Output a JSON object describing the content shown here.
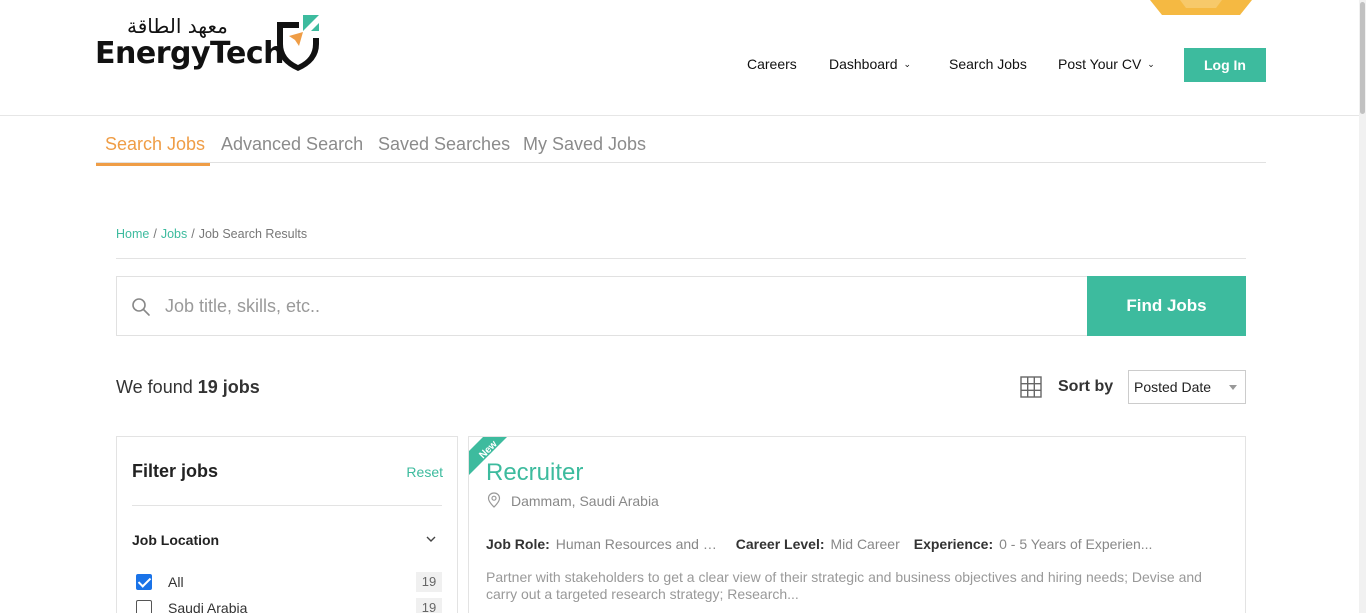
{
  "brand": {
    "arabic_name": "معهد الطاقة",
    "english_name": "EnergyTech"
  },
  "colors": {
    "accent_green": "#3dbb9e",
    "accent_orange": "#ef9d46",
    "checkbox_blue": "#1a73e8"
  },
  "nav": {
    "items": [
      {
        "label": "Careers",
        "dropdown": false
      },
      {
        "label": "Dashboard",
        "dropdown": true
      },
      {
        "label": "Search Jobs",
        "dropdown": false
      },
      {
        "label": "Post Your CV",
        "dropdown": true
      }
    ],
    "login_label": "Log In"
  },
  "tabs": [
    {
      "label": "Search Jobs",
      "active": true
    },
    {
      "label": "Advanced Search",
      "active": false
    },
    {
      "label": "Saved Searches",
      "active": false
    },
    {
      "label": "My Saved Jobs",
      "active": false
    }
  ],
  "breadcrumb": {
    "home": "Home",
    "jobs": "Jobs",
    "current": "Job Search Results",
    "separator": "/"
  },
  "search": {
    "placeholder": "Job title, skills, etc..",
    "value": "",
    "button_label": "Find Jobs"
  },
  "results": {
    "prefix": "We found",
    "count_text": "19 jobs",
    "sort_label": "Sort by",
    "sort_value": "Posted Date"
  },
  "filter": {
    "title": "Filter jobs",
    "reset_label": "Reset",
    "section_title": "Job Location",
    "options": [
      {
        "label": "All",
        "count": "19",
        "checked": true
      },
      {
        "label": "Saudi Arabia",
        "count": "19",
        "checked": false
      }
    ]
  },
  "job": {
    "badge": "New",
    "title": "Recruiter",
    "location": "Dammam, Saudi Arabia",
    "role_label": "Job Role:",
    "role_value": "Human Resources and R...",
    "level_label": "Career Level:",
    "level_value": "Mid Career",
    "exp_label": "Experience:",
    "exp_value": "0 - 5 Years of Experien...",
    "description": "Partner with stakeholders to get a clear view of their strategic and business objectives and hiring needs;  Devise and carry out a targeted research strategy;  Research..."
  }
}
